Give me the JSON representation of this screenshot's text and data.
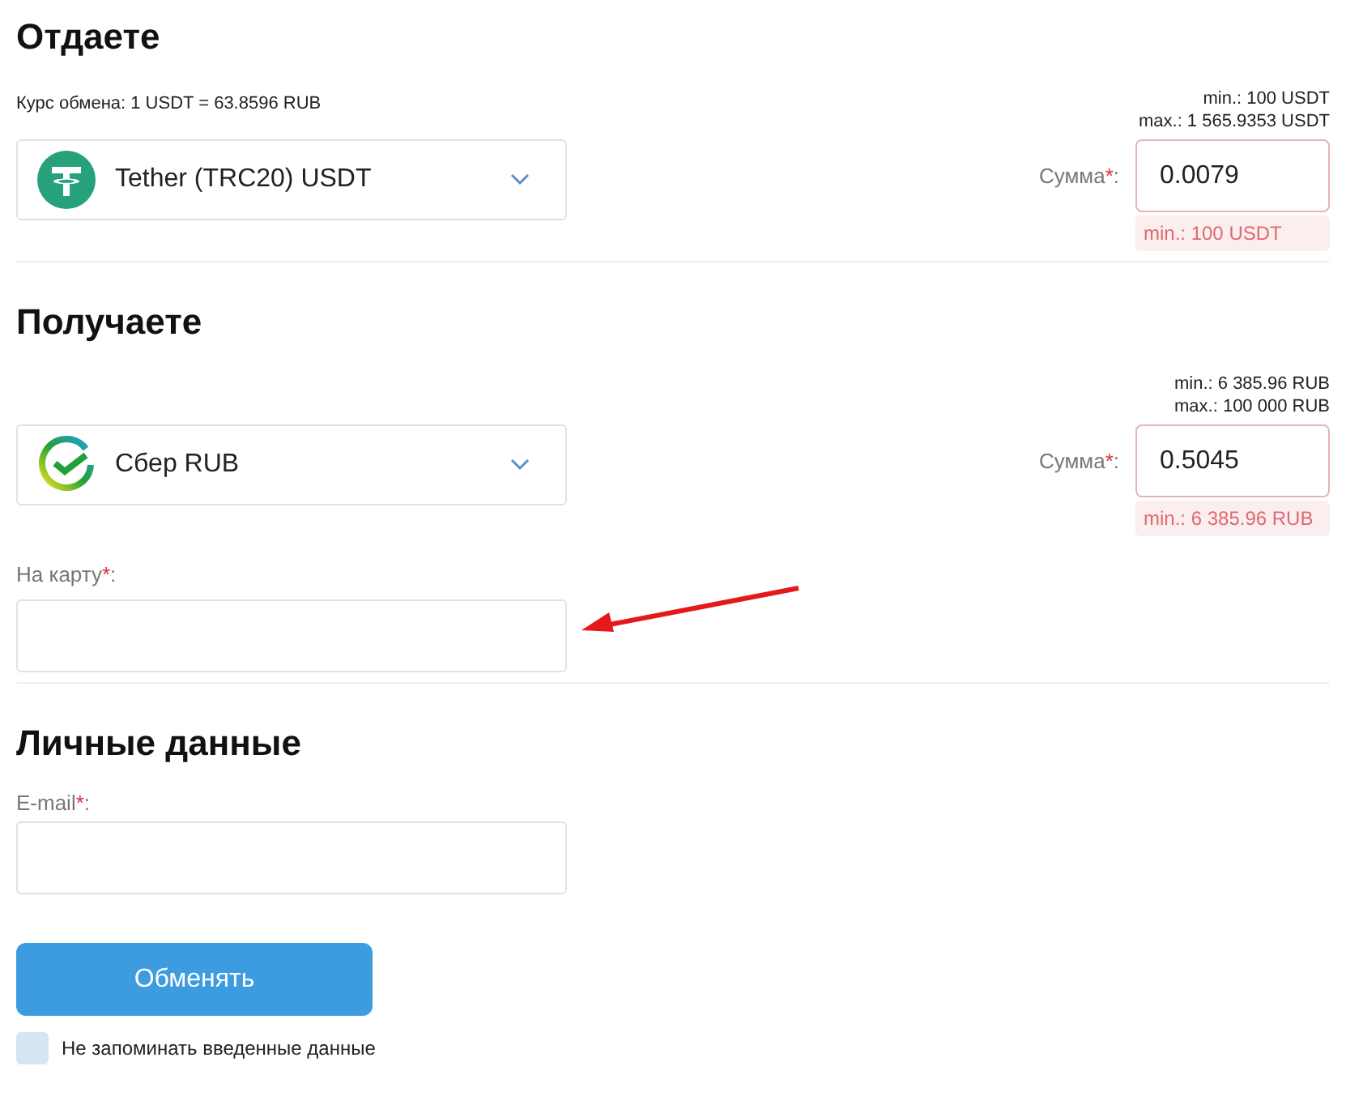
{
  "give": {
    "title": "Отдаете",
    "rate": "Курс обмена: 1 USDT = 63.8596 RUB",
    "limits": [
      "min.: 100 USDT",
      "max.: 1 565.9353 USDT"
    ],
    "currency": {
      "name": "Tether (TRC20) USDT"
    },
    "amount": {
      "label": "Сумма",
      "mark": "*",
      "colon": ":",
      "value": "0.0079",
      "error": "min.: 100 USDT"
    }
  },
  "receive": {
    "title": "Получаете",
    "limits": [
      "min.: 6 385.96 RUB",
      "max.: 100 000 RUB"
    ],
    "currency": {
      "name": "Сбер RUB"
    },
    "amount": {
      "label": "Сумма",
      "mark": "*",
      "colon": ":",
      "value": "0.5045",
      "error": "min.: 6 385.96 RUB"
    },
    "card": {
      "label": "На карту",
      "mark": "*",
      "colon": ":"
    }
  },
  "personal": {
    "title": "Личные данные",
    "email": {
      "label": "E-mail",
      "mark": "*",
      "colon": ":"
    }
  },
  "submit": "Обменять",
  "remember": {
    "label": "Не запоминать введенные данные",
    "checked": false
  }
}
